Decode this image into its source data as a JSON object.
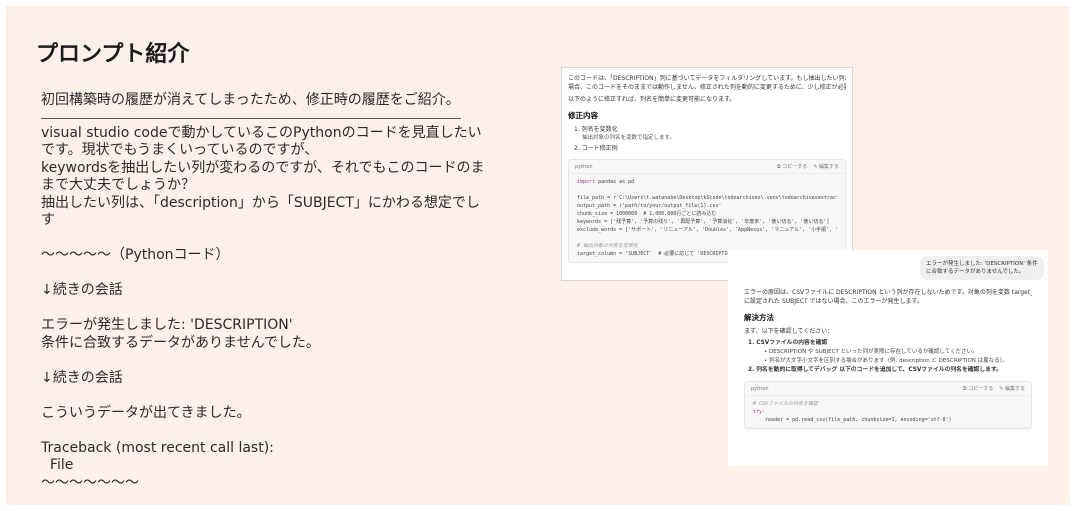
{
  "slide": {
    "title": "プロンプト紹介",
    "intro": "初回構築時の履歴が消えてしまったため、修正時の履歴をご紹介。",
    "body_lines": [
      "visual studio codeで動かしているこのPythonのコードを見直したい",
      "です。現状でもうまくいっているのですが、",
      "keywordsを抽出したい列が変わるのですが、それでもこのコードのま",
      "まで大丈夫でしょうか？",
      "抽出したい列は、「description」から「SUBJECT」にかわる想定でし",
      "す",
      "",
      "～～～～～（Pythonコード）",
      "",
      "↓続きの会話",
      "",
      "エラーが発生しました: 'DESCRIPTION'",
      "条件に合致するデータがありませんでした。",
      "",
      "↓続きの会話",
      "",
      "こういうデータが出てきました。",
      "",
      "Traceback (most recent call last):",
      "  File",
      "～～～～～～～"
    ]
  },
  "shot1": {
    "paragraph": [
      "このコードは、「DESCRIPTION」列に基づいてデータをフィルタリングしています。もし抽出したい列が「SUBJECT」に変わる",
      "場合、このコードをそのままでは動作しません。修正された列を動的に変更するために、少し修正が必要です。"
    ],
    "note": "以下のように修正すれば、列名を簡単に変更可能になります。",
    "heading": "修正内容",
    "items": [
      {
        "label": "1. 列名を変数化",
        "sub": "抽出対象の列名を変数で指定します。"
      },
      {
        "label": "2. コード修正例",
        "sub": ""
      }
    ],
    "code": {
      "lang": "python",
      "copy": "コピーする",
      "edit": "編集する",
      "lines": [
        {
          "kw": "import",
          "rest": " pandas as pd"
        },
        {
          "kw": "",
          "rest": ""
        },
        {
          "kw": "",
          "rest": "file_path = r'C:\\Users\\t.watanabe\\Desktop\\kScode\\todoarchives\\.venv\\todoarchivesextract\\todo"
        },
        {
          "kw": "",
          "rest": "output_path = r'path/to/your/output_file(1).csv'"
        },
        {
          "kw": "",
          "rest": "chunk_size = 1000000  # 1,000,000行ごとに読み込む"
        },
        {
          "kw": "",
          "rest": "keywords = ['残予算', '予算の残り', '再配予算', '予算消化', '年度末', '使い切る', '使い切る']"
        },
        {
          "kw": "",
          "rest": "exclude_words = ['サポート', 'リニューアル', 'Doubles', 'AppNexus', 'マニュアル', '小手順', '据置']"
        },
        {
          "kw": "",
          "rest": ""
        },
        {
          "kw": "",
          "rest": "# 抽出対象の列名を変数化"
        },
        {
          "kw": "",
          "rest": "target_column = 'SUBJECT'  # 必要に応じて 'DESCRIPTION' などに変更可能"
        }
      ]
    }
  },
  "shot2": {
    "bubble": "エラーが発生しました: 'DESCRIPTION'  条件に合致するデータがありませんでした。",
    "paragraph": [
      "エラーの原因は、CSVファイルに DESCRIPTION という列が存在しないためです。対象の列を変数 target_column",
      "に設定された SUBJECT ではない場合、このエラーが発生します。"
    ],
    "heading": "解決方法",
    "intro": "まず、以下を確認してください：",
    "item1": "1. CSVファイルの内容を確認",
    "bullets": [
      "DESCRIPTION や SUBJECT といった列が実際に存在しているか確認してください。",
      "列名が大文字小文字を区別する場合があります（例: description と DESCRIPTION は異なる）。"
    ],
    "item2": "2. 列名を動的に取得してデバッグ 以下のコードを追加して、CSVファイルの列名を確認します。",
    "code": {
      "lang": "python",
      "copy": "コピーする",
      "edit": "編集する",
      "lines": [
        "# CSVファイルの列名を確認",
        "try:",
        "    reader = pd.read_csv(file_path, chunksize=1, encoding='utf-8')"
      ]
    }
  }
}
